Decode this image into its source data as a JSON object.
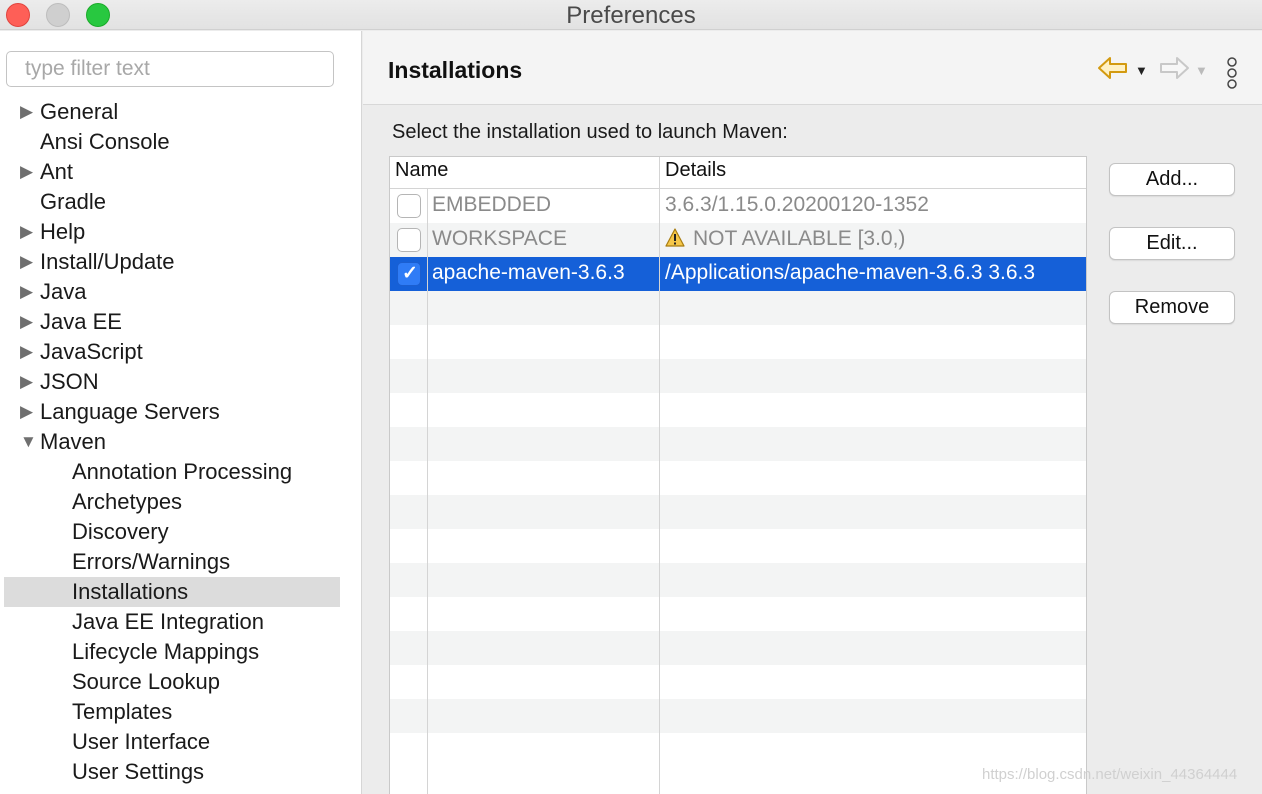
{
  "window": {
    "title": "Preferences"
  },
  "filter": {
    "placeholder": "type filter text",
    "value": ""
  },
  "tree": [
    {
      "label": "General",
      "expandable": true,
      "expanded": false,
      "level": 0
    },
    {
      "label": "Ansi Console",
      "expandable": false,
      "level": 0
    },
    {
      "label": "Ant",
      "expandable": true,
      "expanded": false,
      "level": 0
    },
    {
      "label": "Gradle",
      "expandable": false,
      "level": 0
    },
    {
      "label": "Help",
      "expandable": true,
      "expanded": false,
      "level": 0
    },
    {
      "label": "Install/Update",
      "expandable": true,
      "expanded": false,
      "level": 0
    },
    {
      "label": "Java",
      "expandable": true,
      "expanded": false,
      "level": 0
    },
    {
      "label": "Java EE",
      "expandable": true,
      "expanded": false,
      "level": 0
    },
    {
      "label": "JavaScript",
      "expandable": true,
      "expanded": false,
      "level": 0
    },
    {
      "label": "JSON",
      "expandable": true,
      "expanded": false,
      "level": 0
    },
    {
      "label": "Language Servers",
      "expandable": true,
      "expanded": false,
      "level": 0
    },
    {
      "label": "Maven",
      "expandable": true,
      "expanded": true,
      "level": 0
    },
    {
      "label": "Annotation Processing",
      "level": 1
    },
    {
      "label": "Archetypes",
      "level": 1
    },
    {
      "label": "Discovery",
      "level": 1
    },
    {
      "label": "Errors/Warnings",
      "level": 1
    },
    {
      "label": "Installations",
      "level": 1,
      "selected": true
    },
    {
      "label": "Java EE Integration",
      "level": 1
    },
    {
      "label": "Lifecycle Mappings",
      "level": 1
    },
    {
      "label": "Source Lookup",
      "level": 1
    },
    {
      "label": "Templates",
      "level": 1
    },
    {
      "label": "User Interface",
      "level": 1
    },
    {
      "label": "User Settings",
      "level": 1
    }
  ],
  "page": {
    "title": "Installations",
    "prompt": "Select the installation used to launch Maven:"
  },
  "table": {
    "columns": [
      "Name",
      "Details"
    ],
    "rows": [
      {
        "checked": false,
        "name": "EMBEDDED",
        "details": "3.6.3/1.15.0.20200120-1352",
        "warning": false,
        "selected": false
      },
      {
        "checked": false,
        "name": "WORKSPACE",
        "details": "NOT AVAILABLE [3.0,)",
        "warning": true,
        "selected": false
      },
      {
        "checked": true,
        "name": "apache-maven-3.6.3",
        "details": "/Applications/apache-maven-3.6.3 3.6.3",
        "warning": false,
        "selected": true
      }
    ],
    "empty_rows": 14
  },
  "buttons": {
    "add": "Add...",
    "edit": "Edit...",
    "remove": "Remove"
  },
  "watermark": "https://blog.csdn.net/weixin_44364444",
  "colors": {
    "selection": "#1560d8",
    "checkbox_on": "#2f7cf6",
    "close": "#fe5f57",
    "maximize": "#28c840",
    "nav_back": "#d9a520"
  }
}
